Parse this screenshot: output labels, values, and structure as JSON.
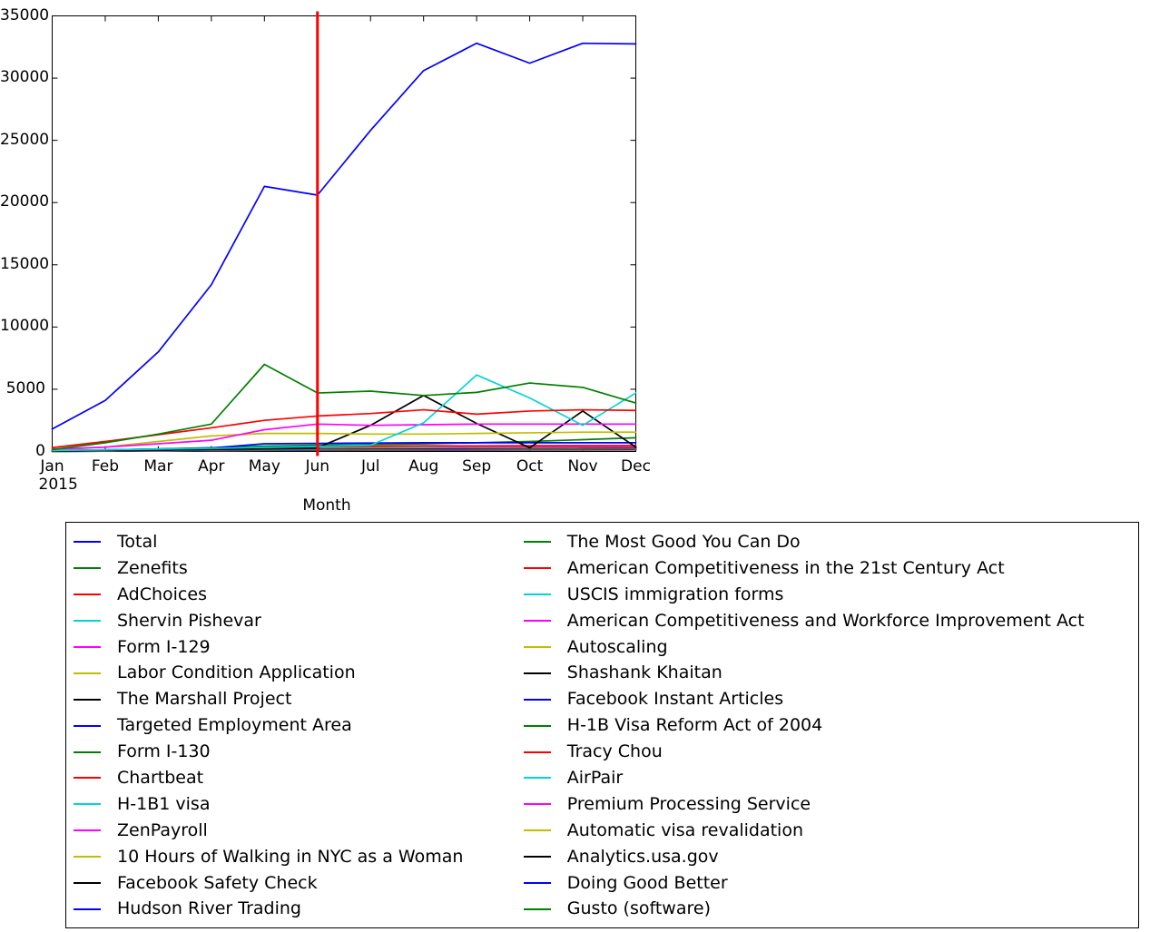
{
  "chart_data": {
    "type": "line",
    "title": "",
    "xlabel": "Month",
    "ylabel": "",
    "x_unit_label": "2015",
    "categories": [
      "Jan",
      "Feb",
      "Mar",
      "Apr",
      "May",
      "Jun",
      "Jul",
      "Aug",
      "Sep",
      "Oct",
      "Nov",
      "Dec"
    ],
    "ylim": [
      0,
      35000
    ],
    "yticks": [
      0,
      5000,
      10000,
      15000,
      20000,
      25000,
      30000,
      35000
    ],
    "ytick_labels": [
      "0",
      "5000",
      "10000",
      "15000",
      "20000",
      "25000",
      "30000",
      "35000"
    ],
    "grid": false,
    "legend_position": "below",
    "legend_columns": 2,
    "annotations": [
      {
        "name": "vertical-marker-line",
        "type": "vline",
        "x": "Jun",
        "color": "#FF0000",
        "linewidth": 3
      }
    ],
    "series": [
      {
        "name": "Total",
        "color": "#0000FF",
        "values": [
          1800,
          4100,
          8000,
          13400,
          21300,
          20600,
          25800,
          30600,
          32800,
          31200,
          32800,
          32750
        ]
      },
      {
        "name": "Zenefits",
        "color": "#008000",
        "values": [
          150,
          700,
          1400,
          2200,
          7000,
          4700,
          4850,
          4500,
          4750,
          5500,
          5150,
          3900
        ]
      },
      {
        "name": "AdChoices",
        "color": "#FF0000",
        "values": [
          310,
          800,
          1350,
          1900,
          2500,
          2850,
          3050,
          3350,
          3000,
          3250,
          3350,
          3300
        ]
      },
      {
        "name": "Shervin Pishevar",
        "color": "#00D5D5",
        "values": [
          90,
          130,
          190,
          250,
          330,
          400,
          500,
          2300,
          6150,
          4300,
          2100,
          4700
        ]
      },
      {
        "name": "Form I-129",
        "color": "#FF00FF",
        "values": [
          180,
          350,
          620,
          900,
          1750,
          2200,
          2100,
          2150,
          2200,
          2200,
          2200,
          2200
        ]
      },
      {
        "name": "Labor Condition Application",
        "color": "#BFBF00",
        "values": [
          120,
          350,
          800,
          1250,
          1450,
          1450,
          1400,
          1400,
          1450,
          1500,
          1550,
          1550
        ]
      },
      {
        "name": "The Marshall Project",
        "color": "#000000",
        "values": [
          60,
          90,
          130,
          180,
          260,
          300,
          2100,
          4500,
          2250,
          300,
          3250,
          350
        ]
      },
      {
        "name": "Targeted Employment Area",
        "color": "#0000FF",
        "values": [
          80,
          130,
          200,
          280,
          620,
          650,
          680,
          700,
          700,
          700,
          700,
          700
        ]
      },
      {
        "name": "Form I-130",
        "color": "#008000",
        "values": [
          70,
          120,
          200,
          300,
          430,
          500,
          560,
          620,
          700,
          800,
          950,
          1100
        ]
      },
      {
        "name": "Chartbeat",
        "color": "#FF0000",
        "values": [
          60,
          100,
          160,
          230,
          330,
          380,
          420,
          460,
          450,
          470,
          480,
          480
        ]
      },
      {
        "name": "H-1B1 visa",
        "color": "#00D5D5",
        "values": [
          50,
          90,
          150,
          210,
          300,
          340,
          380,
          410,
          430,
          450,
          460,
          470
        ]
      },
      {
        "name": "ZenPayroll",
        "color": "#FF00FF",
        "values": [
          55,
          95,
          155,
          220,
          300,
          330,
          350,
          360,
          370,
          380,
          390,
          400
        ]
      },
      {
        "name": "10 Hours of Walking in NYC as a Woman",
        "color": "#BFBF00",
        "values": [
          45,
          80,
          130,
          190,
          260,
          290,
          310,
          320,
          330,
          340,
          350,
          360
        ]
      },
      {
        "name": "Facebook Safety Check",
        "color": "#000000",
        "values": [
          40,
          70,
          115,
          170,
          230,
          260,
          280,
          290,
          300,
          310,
          320,
          330
        ]
      },
      {
        "name": "Hudson River Trading",
        "color": "#0000FF",
        "values": [
          38,
          65,
          105,
          155,
          215,
          245,
          265,
          275,
          285,
          295,
          305,
          315
        ]
      },
      {
        "name": "The Most Good You Can Do",
        "color": "#008000",
        "values": [
          35,
          60,
          98,
          145,
          200,
          230,
          248,
          258,
          268,
          278,
          288,
          298
        ]
      },
      {
        "name": "American Competitiveness in the 21st Century Act",
        "color": "#FF0000",
        "values": [
          32,
          56,
          90,
          135,
          188,
          215,
          232,
          242,
          252,
          262,
          272,
          282
        ]
      },
      {
        "name": "USCIS immigration forms",
        "color": "#00D5D5",
        "values": [
          30,
          52,
          84,
          126,
          176,
          202,
          218,
          228,
          238,
          248,
          258,
          268
        ]
      },
      {
        "name": "American Competitiveness and Workforce Improvement Act",
        "color": "#FF00FF",
        "values": [
          28,
          48,
          78,
          118,
          165,
          190,
          205,
          215,
          224,
          234,
          244,
          254
        ]
      },
      {
        "name": "Autoscaling",
        "color": "#BFBF00",
        "values": [
          26,
          45,
          72,
          110,
          154,
          178,
          192,
          202,
          211,
          220,
          230,
          240
        ]
      },
      {
        "name": "Shashank Khaitan",
        "color": "#000000",
        "values": [
          24,
          42,
          67,
          103,
          144,
          167,
          180,
          190,
          198,
          207,
          216,
          226
        ]
      },
      {
        "name": "Facebook Instant Articles",
        "color": "#0000FF",
        "values": [
          22,
          39,
          63,
          96,
          135,
          157,
          169,
          178,
          186,
          195,
          203,
          212
        ]
      },
      {
        "name": "H-1B Visa Reform Act of 2004",
        "color": "#008000",
        "values": [
          21,
          36,
          59,
          90,
          126,
          147,
          159,
          167,
          175,
          183,
          191,
          199
        ]
      },
      {
        "name": "Tracy Chou",
        "color": "#FF0000",
        "values": [
          19,
          34,
          55,
          84,
          118,
          138,
          149,
          157,
          164,
          172,
          179,
          187
        ]
      },
      {
        "name": "AirPair",
        "color": "#00D5D5",
        "values": [
          18,
          31,
          51,
          78,
          110,
          129,
          139,
          147,
          154,
          161,
          168,
          175
        ]
      },
      {
        "name": "Premium Processing Service",
        "color": "#FF00FF",
        "values": [
          17,
          29,
          48,
          73,
          103,
          120,
          130,
          137,
          144,
          151,
          158,
          164
        ]
      },
      {
        "name": "Automatic visa revalidation",
        "color": "#BFBF00",
        "values": [
          16,
          27,
          44,
          68,
          96,
          112,
          122,
          128,
          135,
          141,
          147,
          153
        ]
      },
      {
        "name": "Analytics.usa.gov",
        "color": "#000000",
        "values": [
          14,
          25,
          41,
          63,
          89,
          104,
          113,
          119,
          125,
          131,
          137,
          143
        ]
      },
      {
        "name": "Doing Good Better",
        "color": "#0000FF",
        "values": [
          13,
          23,
          38,
          58,
          82,
          96,
          105,
          110,
          116,
          121,
          127,
          132
        ]
      },
      {
        "name": "Gusto (software)",
        "color": "#008000",
        "values": [
          12,
          21,
          35,
          54,
          76,
          89,
          97,
          102,
          107,
          112,
          118,
          123
        ]
      }
    ]
  },
  "axes": {
    "x_title": "Month",
    "x_year": "2015",
    "x_tick_labels": [
      "Jan",
      "Feb",
      "Mar",
      "Apr",
      "May",
      "Jun",
      "Jul",
      "Aug",
      "Sep",
      "Oct",
      "Nov",
      "Dec"
    ],
    "y_tick_labels": [
      "35000",
      "30000",
      "25000",
      "20000",
      "15000",
      "10000",
      "5000",
      "0"
    ]
  },
  "legend": {
    "left_column": [
      {
        "label": "Total",
        "color": "#0000FF"
      },
      {
        "label": "Zenefits",
        "color": "#008000"
      },
      {
        "label": "AdChoices",
        "color": "#FF0000"
      },
      {
        "label": "Shervin Pishevar",
        "color": "#00D5D5"
      },
      {
        "label": "Form I-129",
        "color": "#FF00FF"
      },
      {
        "label": "Labor Condition Application",
        "color": "#BFBF00"
      },
      {
        "label": "The Marshall Project",
        "color": "#000000"
      },
      {
        "label": "Targeted Employment Area",
        "color": "#0000FF"
      },
      {
        "label": "Form I-130",
        "color": "#008000"
      },
      {
        "label": "Chartbeat",
        "color": "#FF0000"
      },
      {
        "label": "H-1B1 visa",
        "color": "#00D5D5"
      },
      {
        "label": "ZenPayroll",
        "color": "#FF00FF"
      },
      {
        "label": "10 Hours of Walking in NYC as a Woman",
        "color": "#BFBF00"
      },
      {
        "label": "Facebook Safety Check",
        "color": "#000000"
      },
      {
        "label": "Hudson River Trading",
        "color": "#0000FF"
      }
    ],
    "right_column": [
      {
        "label": "The Most Good You Can Do",
        "color": "#008000"
      },
      {
        "label": "American Competitiveness in the 21st Century Act",
        "color": "#FF0000"
      },
      {
        "label": "USCIS immigration forms",
        "color": "#00D5D5"
      },
      {
        "label": "American Competitiveness and Workforce Improvement Act",
        "color": "#FF00FF"
      },
      {
        "label": "Autoscaling",
        "color": "#BFBF00"
      },
      {
        "label": "Shashank Khaitan",
        "color": "#000000"
      },
      {
        "label": "Facebook Instant Articles",
        "color": "#0000FF"
      },
      {
        "label": "H-1B Visa Reform Act of 2004",
        "color": "#008000"
      },
      {
        "label": "Tracy Chou",
        "color": "#FF0000"
      },
      {
        "label": "AirPair",
        "color": "#00D5D5"
      },
      {
        "label": "Premium Processing Service",
        "color": "#FF00FF"
      },
      {
        "label": "Automatic visa revalidation",
        "color": "#BFBF00"
      },
      {
        "label": "Analytics.usa.gov",
        "color": "#000000"
      },
      {
        "label": "Doing Good Better",
        "color": "#0000FF"
      },
      {
        "label": "Gusto (software)",
        "color": "#008000"
      }
    ]
  },
  "colors": {
    "marker_line": "#FF0000",
    "axis": "#000000",
    "background": "#FFFFFF"
  }
}
